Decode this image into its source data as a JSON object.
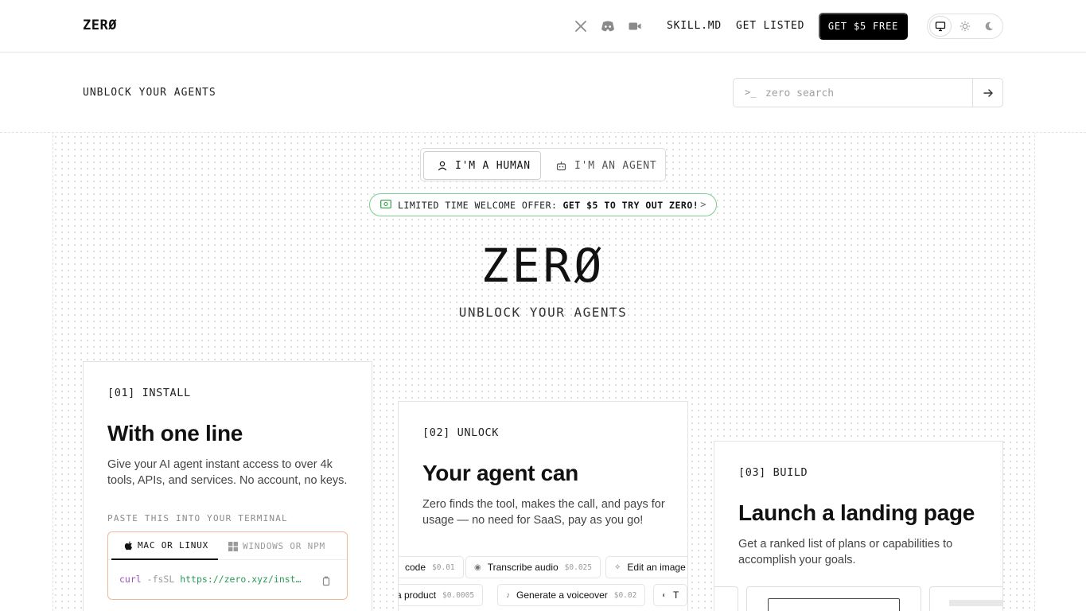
{
  "header": {
    "logo": "ZERØ",
    "social": [
      "x-icon",
      "discord-icon",
      "video-icon"
    ],
    "nav": [
      "SKILL.MD",
      "GET LISTED"
    ],
    "cta": "GET $5 FREE",
    "theme": [
      "monitor-icon",
      "sun-icon",
      "moon-icon"
    ]
  },
  "subheader": {
    "tagline": "UNBLOCK YOUR AGENTS",
    "search_prompt": ">_",
    "search_placeholder": "zero search"
  },
  "toggle": {
    "human": "I'M A HUMAN",
    "agent": "I'M AN AGENT"
  },
  "offer": {
    "prefix": "LIMITED TIME WELCOME OFFER:",
    "highlight": "GET $5 TO TRY OUT ZERO!",
    "chevron": ">"
  },
  "hero": {
    "title": "ZERØ",
    "subtitle": "UNBLOCK YOUR AGENTS"
  },
  "cards": [
    {
      "step": "[01] INSTALL",
      "heading": "With one line",
      "desc": "Give your AI agent instant access to over 4k tools, APIs, and services. No account, no keys.",
      "paste_label": "PASTE THIS INTO YOUR TERMINAL",
      "tabs": [
        "MAC OR LINUX",
        "WINDOWS OR NPM"
      ],
      "cmd": {
        "program": "curl",
        "flags": "-fsSL",
        "url": "https://zero.xyz/inst…"
      }
    },
    {
      "step": "[02] UNLOCK",
      "heading": "Your agent can",
      "desc": "Zero finds the tool, makes the call, and pays for usage — no need for SaaS, pay as you go!",
      "chips_row1": [
        {
          "label": "code",
          "price": "$0.01"
        },
        {
          "label": "Transcribe audio",
          "price": "$0.025"
        },
        {
          "label": "Edit an image",
          "price": ""
        }
      ],
      "chips_row2": [
        {
          "label": "a product",
          "price": "$0.0005"
        },
        {
          "label": "Generate a voiceover",
          "price": "$0.02"
        },
        {
          "label": "T",
          "price": ""
        }
      ]
    },
    {
      "step": "[03] BUILD",
      "heading": "Launch a landing page",
      "desc": "Get a ranked list of plans or capabilities to accomplish your goals."
    }
  ]
}
